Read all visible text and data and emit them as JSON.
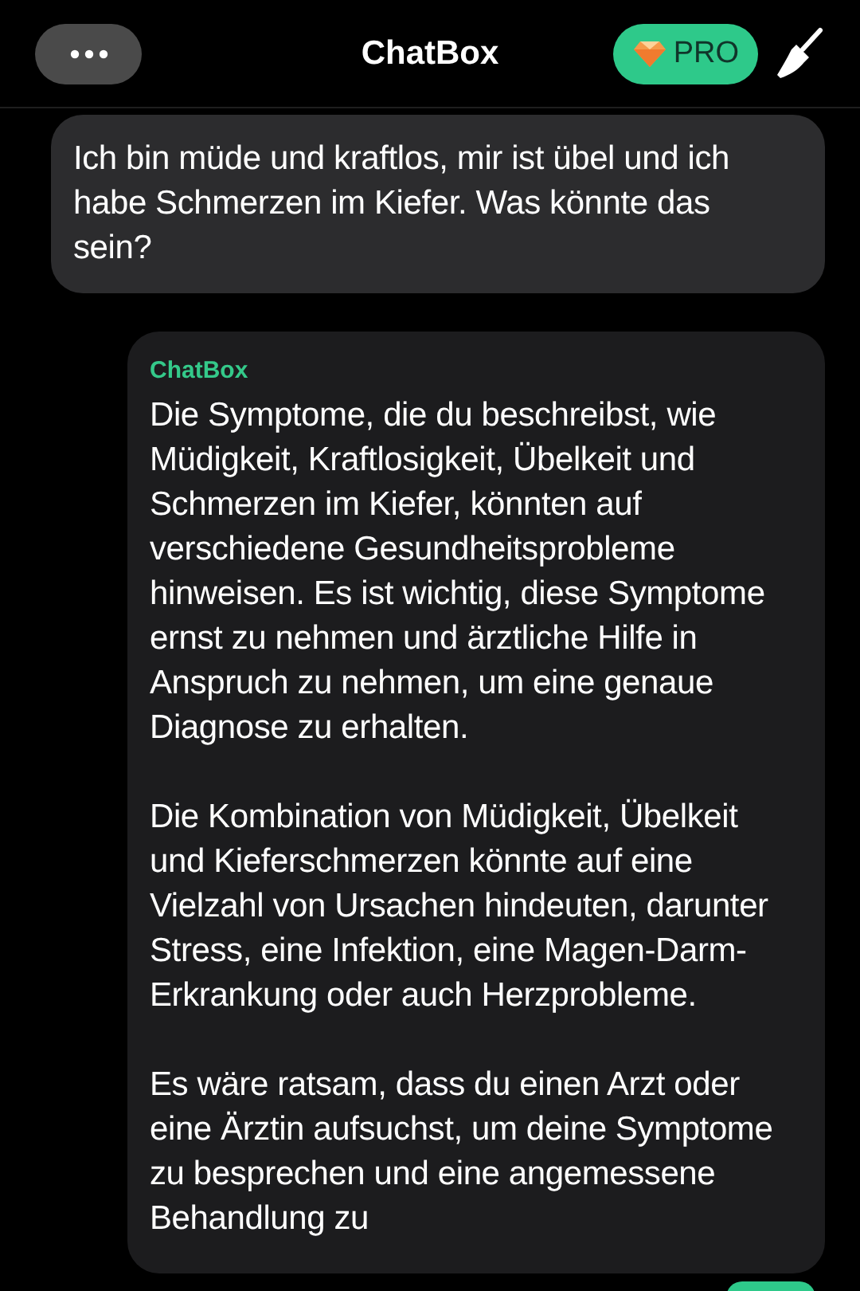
{
  "header": {
    "title": "ChatBox",
    "pro_badge": "PRO"
  },
  "messages": [
    {
      "kind": "user",
      "paragraphs": [
        "Ich bin müde und kraftlos, mir ist übel und ich habe Schmerzen im Kiefer. Was könnte das sein?"
      ]
    },
    {
      "kind": "assistant",
      "sender": "ChatBox",
      "paragraphs": [
        "Die Symptome, die du beschreibst, wie Müdigkeit, Kraftlosigkeit, Übelkeit und Schmerzen im Kiefer, könnten auf verschiedene Gesundheitsprobleme hinweisen. Es ist wichtig, diese Symptome ernst zu nehmen und ärztliche Hilfe in Anspruch zu nehmen, um eine genaue Diagnose zu erhalten.",
        "Die Kombination von Müdigkeit, Übelkeit und Kieferschmerzen könnte auf eine Vielzahl von Ursachen hindeuten, darunter Stress, eine Infektion, eine Magen-Darm-Erkrankung oder auch Herzprobleme.",
        "Es wäre ratsam, dass du einen Arzt oder eine Ärztin aufsuchst, um deine Symptome zu besprechen und eine angemessene Behandlung zu"
      ]
    }
  ]
}
